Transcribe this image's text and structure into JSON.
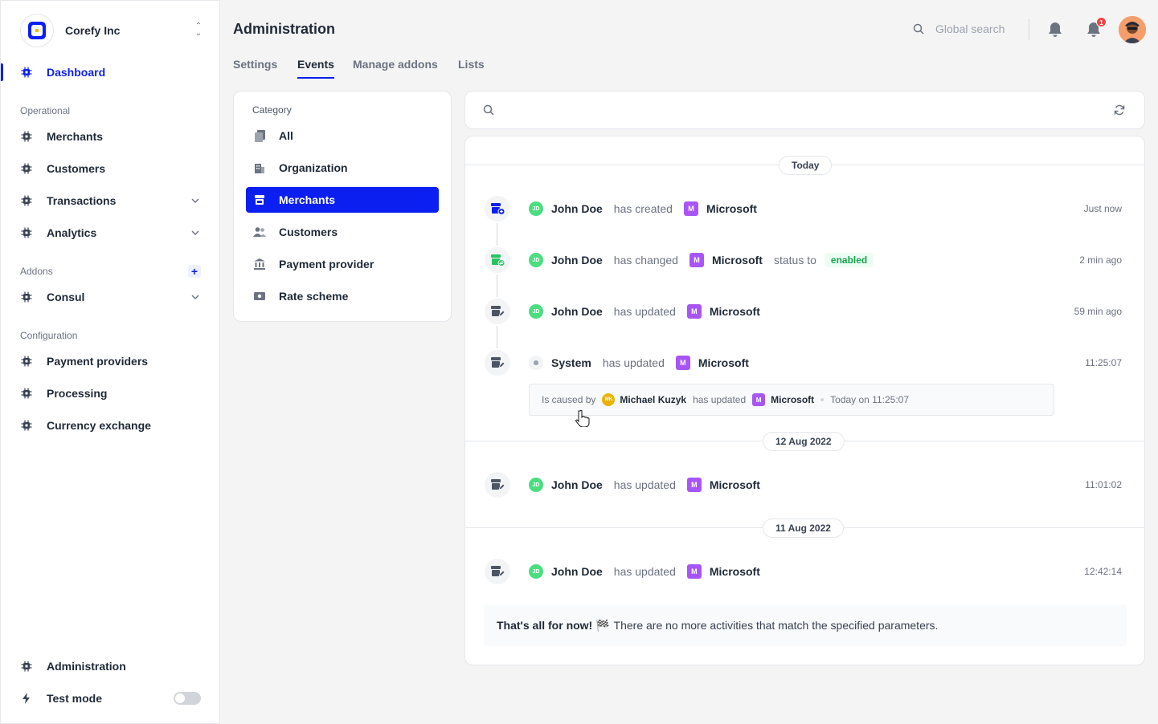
{
  "sidebar": {
    "org_name": "Corefy Inc",
    "dashboard": "Dashboard",
    "sections": {
      "operational": "Operational",
      "addons": "Addons",
      "configuration": "Configuration"
    },
    "items": {
      "merchants": "Merchants",
      "customers": "Customers",
      "transactions": "Transactions",
      "analytics": "Analytics",
      "consul": "Consul",
      "payment_providers": "Payment providers",
      "processing": "Processing",
      "currency_exchange": "Currency exchange",
      "administration": "Administration",
      "test_mode": "Test mode"
    },
    "test_mode_on": false
  },
  "header": {
    "title": "Administration",
    "search_placeholder": "Global search",
    "notification_count": "1"
  },
  "tabs": [
    "Settings",
    "Events",
    "Manage addons",
    "Lists"
  ],
  "active_tab": "Events",
  "category": {
    "title": "Category",
    "items": [
      "All",
      "Organization",
      "Merchants",
      "Customers",
      "Payment provider",
      "Rate scheme"
    ],
    "selected": "Merchants"
  },
  "events": {
    "groups": [
      {
        "date": "Today",
        "rows": [
          {
            "initials": "JD",
            "actor": "John Doe",
            "verb": "has created",
            "entity_initial": "M",
            "entity": "Microsoft",
            "time": "Just now"
          },
          {
            "initials": "JD",
            "actor": "John Doe",
            "verb": "has changed",
            "entity_initial": "M",
            "entity": "Microsoft",
            "status_to": "status to",
            "status": "enabled",
            "time": "2 min ago"
          },
          {
            "initials": "JD",
            "actor": "John Doe",
            "verb": "has updated",
            "entity_initial": "M",
            "entity": "Microsoft",
            "time": "59 min ago"
          },
          {
            "actor": "System",
            "verb": "has updated",
            "entity_initial": "M",
            "entity": "Microsoft",
            "time": "11:25:07"
          }
        ]
      },
      {
        "date": "12 Aug 2022",
        "rows": [
          {
            "initials": "JD",
            "actor": "John Doe",
            "verb": "has updated",
            "entity_initial": "M",
            "entity": "Microsoft",
            "time": "11:01:02"
          }
        ]
      },
      {
        "date": "11 Aug 2022",
        "rows": [
          {
            "initials": "JD",
            "actor": "John Doe",
            "verb": "has updated",
            "entity_initial": "M",
            "entity": "Microsoft",
            "time": "12:42:14"
          }
        ]
      }
    ],
    "caused_by": {
      "label": "Is caused by",
      "initials": "MK",
      "actor": "Michael Kuzyk",
      "verb": "has updated",
      "entity_initial": "M",
      "entity": "Microsoft",
      "time": "Today on 11:25:07"
    },
    "end_message": {
      "strong": "That's all for now! 🏁",
      "text": "There are no more activities that match the specified parameters."
    }
  },
  "colors": {
    "accent": "#0b1ff0",
    "entity_badge": "#a855f7",
    "actor_avatar": "#4ade80",
    "status_enabled": "#16a34a"
  }
}
